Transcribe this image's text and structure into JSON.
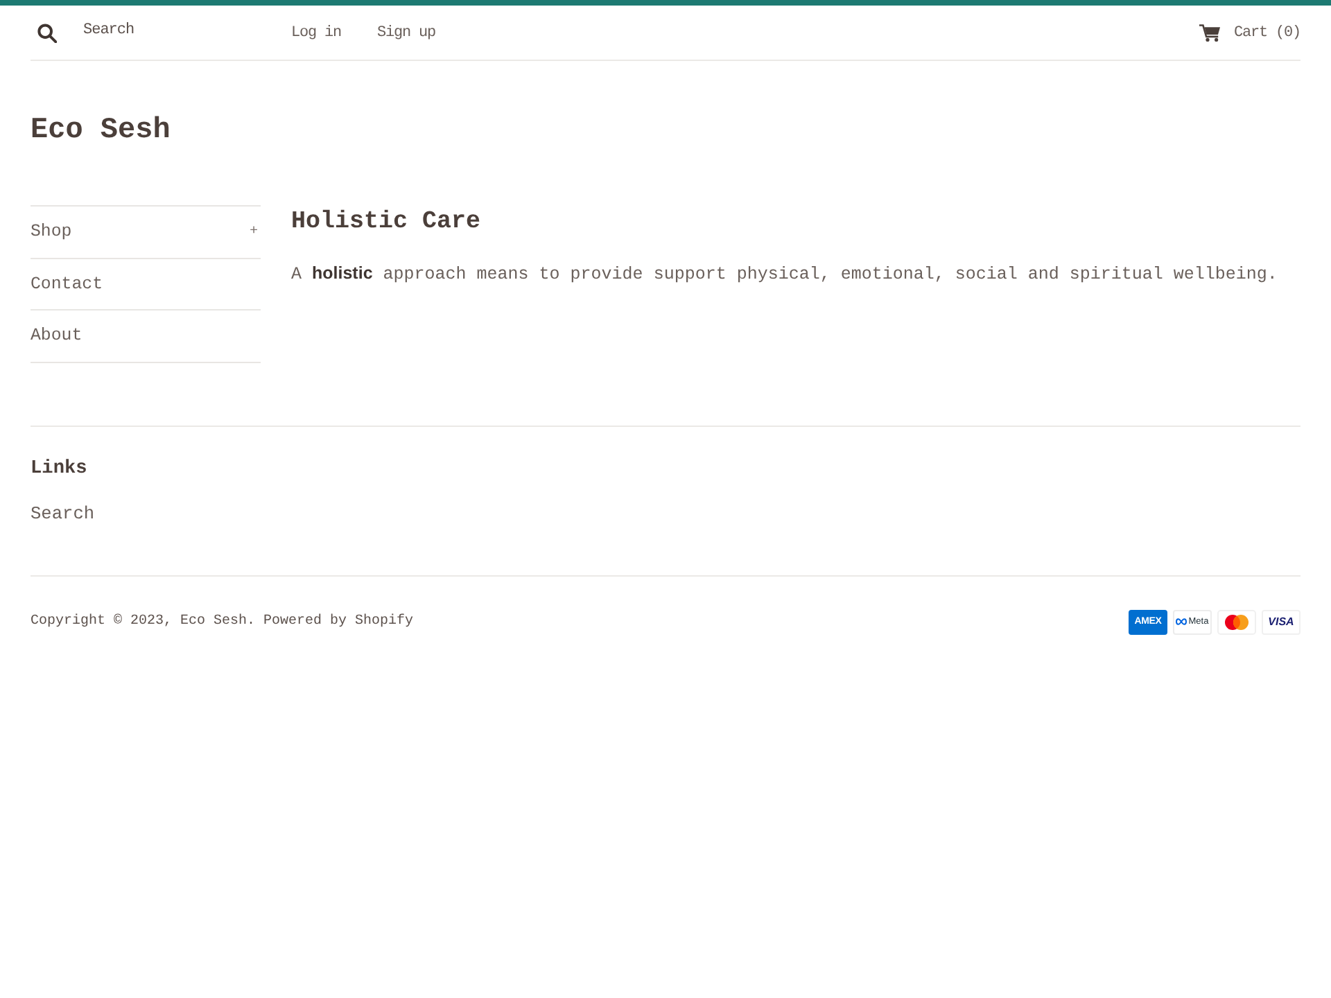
{
  "header": {
    "search": {
      "placeholder": "Search"
    },
    "account_links": [
      "Log in",
      "Sign up"
    ],
    "cart": {
      "label": "Cart (0)"
    }
  },
  "site_title": "Eco Sesh",
  "sidebar": {
    "items": [
      {
        "label": "Shop",
        "toggle": "+"
      },
      {
        "label": "Contact"
      },
      {
        "label": "About"
      }
    ]
  },
  "page": {
    "title": "Holistic Care",
    "body": "A **holistic** approach means to provide support physical, emotional, social and spiritual wellbeing."
  },
  "footer": {
    "links_heading": "Links",
    "links": [
      "Search"
    ],
    "copyright": "Copyright © 2023, Eco Sesh. Powered by Shopify",
    "payment_icons": [
      {
        "kind": "amex",
        "label": "AMEX"
      },
      {
        "kind": "meta",
        "label": "Meta"
      },
      {
        "kind": "mastercard"
      },
      {
        "kind": "visa",
        "label": "VISA"
      }
    ]
  }
}
